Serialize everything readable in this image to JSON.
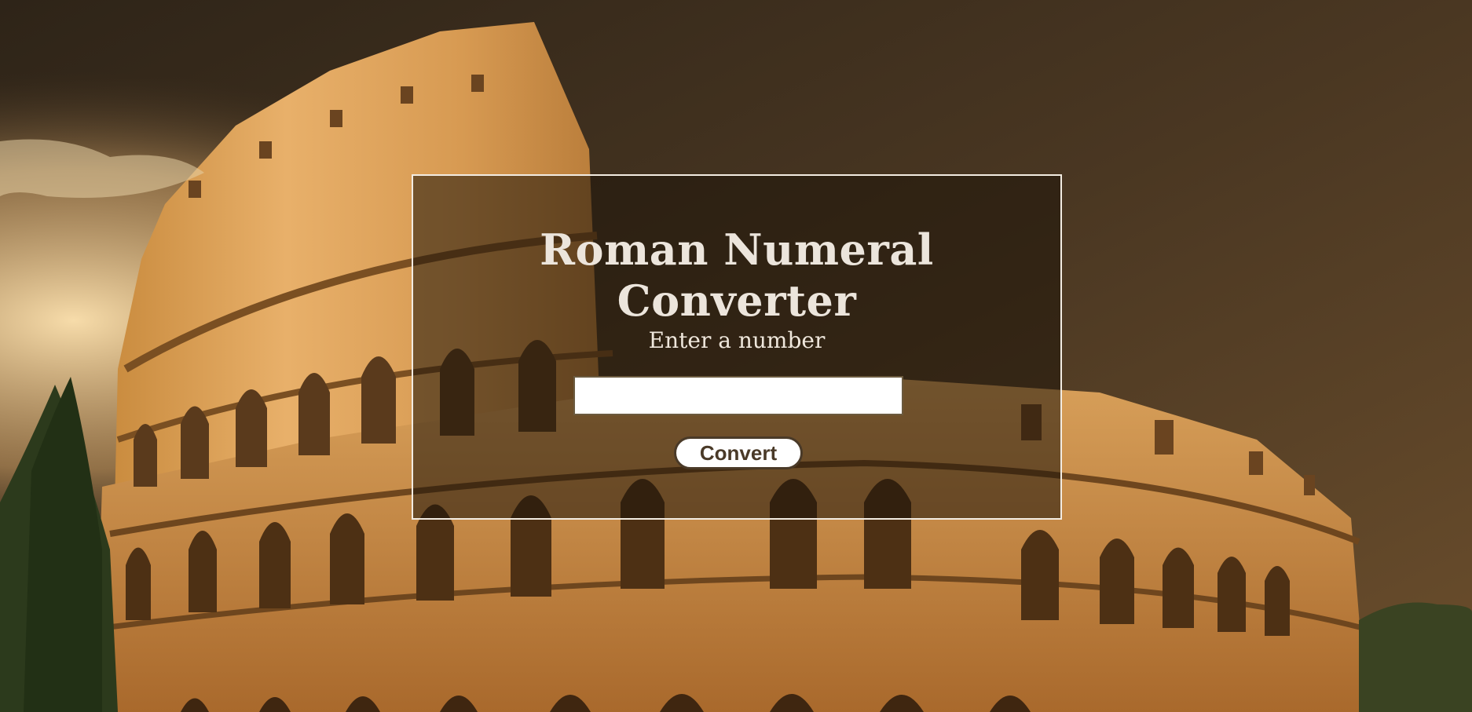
{
  "app": {
    "title": "Roman Numeral Converter"
  },
  "form": {
    "label": "Enter a number",
    "input_value": "",
    "input_placeholder": "",
    "convert_label": "Convert"
  },
  "theme": {
    "panel_border": "#f3ece2",
    "title_color": "#ece5dc",
    "button_text": "#4a3a28"
  },
  "background": {
    "subject": "colosseum-photo"
  }
}
